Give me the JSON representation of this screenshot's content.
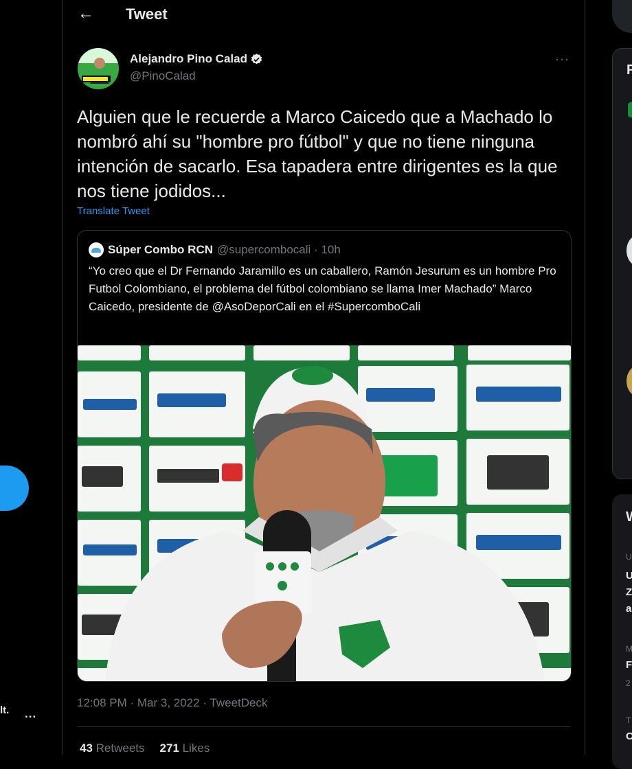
{
  "sidebar": {
    "user_text": "lt.",
    "more_label": "..."
  },
  "header": {
    "back_icon": "←",
    "title": "Tweet"
  },
  "tweet": {
    "author_name": "Alejandro Pino Calad",
    "author_handle": "@PinoCalad",
    "more_label": "···",
    "text": "Alguien que le recuerde a Marco Caicedo que a Machado lo nombró ahí su \"hombre pro fútbol\" y que no tiene ninguna intención de sacarlo. Esa tapadera entre dirigentes es la que nos tiene jodidos...",
    "translate_label": "Translate Tweet",
    "timestamp": "12:08 PM · Mar 3, 2022 · TweetDeck",
    "retweets_count": "43",
    "retweets_label": "Retweets",
    "likes_count": "271",
    "likes_label": "Likes"
  },
  "quote": {
    "name": "Súper Combo RCN",
    "handle_time": "@supercombocali · 10h",
    "text": "“Yo creo que el Dr Fernando Jaramillo es un caballero, Ramón Jesurum es un hombre Pro Futbol Colombiano, el problema del fútbol colombiano se llama Imer Machado” Marco Caicedo, presidente de @AsoDeporCali en el #SupercomboCali"
  },
  "right": {
    "card1_letter": "F",
    "card2_letter": "W",
    "trend_lines": [
      "U",
      "U",
      "Z",
      "a",
      "M",
      "F",
      "2",
      "T",
      "C"
    ]
  },
  "colors": {
    "accent": "#1d9bf0",
    "background": "#000000",
    "secondary_text": "#71767b",
    "border": "#2f3336"
  }
}
